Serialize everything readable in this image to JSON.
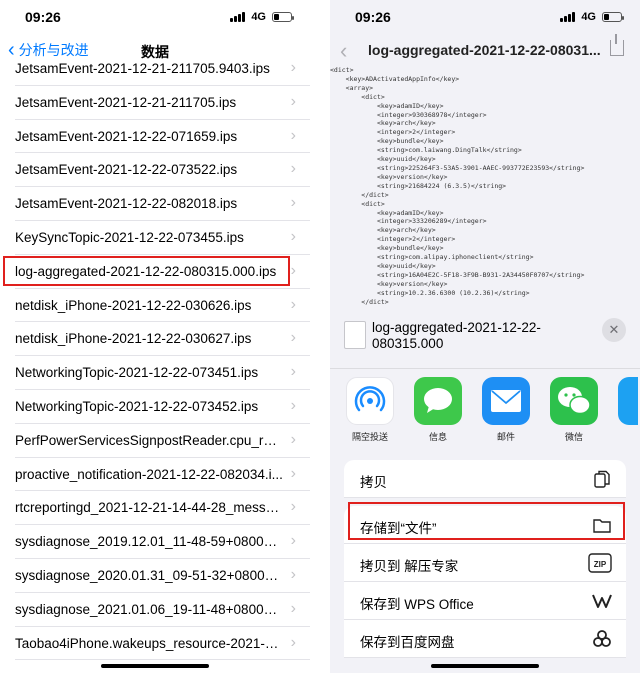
{
  "status": {
    "time": "09:26",
    "network": "4G"
  },
  "left": {
    "back_label": "分析与改进",
    "title": "数据",
    "items": [
      "JetsamEvent-2021-12-21-211705.9403.ips",
      "JetsamEvent-2021-12-21-211705.ips",
      "JetsamEvent-2021-12-22-071659.ips",
      "JetsamEvent-2021-12-22-073522.ips",
      "JetsamEvent-2021-12-22-082018.ips",
      "KeySyncTopic-2021-12-22-073455.ips",
      "log-aggregated-2021-12-22-080315.000.ips",
      "netdisk_iPhone-2021-12-22-030626.ips",
      "netdisk_iPhone-2021-12-22-030627.ips",
      "NetworkingTopic-2021-12-22-073451.ips",
      "NetworkingTopic-2021-12-22-073452.ips",
      "PerfPowerServicesSignpostReader.cpu_reso...",
      "proactive_notification-2021-12-22-082034.i...",
      "rtcreportingd_2021-12-21-14-44-28_messa...",
      "sysdiagnose_2019.12.01_11-48-59+0800_iP...",
      "sysdiagnose_2020.01.31_09-51-32+0800_i...",
      "sysdiagnose_2021.01.06_19-11-48+0800_iP...",
      "Taobao4iPhone.wakeups_resource-2021-12..."
    ]
  },
  "right": {
    "title": "log-aggregated-2021-12-22-08031...",
    "plist_lines": [
      "<dict>",
      "    <key>ADActivatedAppInfo</key>",
      "    <array>",
      "        <dict>",
      "            <key>adamID</key>",
      "            <integer>930368978</integer>",
      "            <key>arch</key>",
      "            <integer>2</integer>",
      "            <key>bundle</key>",
      "            <string>com.laiwang.DingTalk</string>",
      "            <key>uuid</key>",
      "            <string>225264F3-53A5-3901-AAEC-993772E23593</string>",
      "            <key>version</key>",
      "            <string>21684224 (6.3.5)</string>",
      "        </dict>",
      "        <dict>",
      "            <key>adamID</key>",
      "            <integer>333206289</integer>",
      "            <key>arch</key>",
      "            <integer>2</integer>",
      "            <key>bundle</key>",
      "            <string>com.alipay.iphoneclient</string>",
      "            <key>uuid</key>",
      "            <string>16A04E2C-5F18-3F9B-B931-2A34450F0707</string>",
      "            <key>version</key>",
      "            <string>10.2.36.6300 (10.2.36)</string>",
      "        </dict>"
    ],
    "file_name": "log-aggregated-2021-12-22-080315.000",
    "apps": [
      {
        "label": "隔空投送",
        "icon": "airdrop-icon"
      },
      {
        "label": "信息",
        "icon": "messages-icon"
      },
      {
        "label": "邮件",
        "icon": "mail-icon"
      },
      {
        "label": "微信",
        "icon": "wechat-icon"
      }
    ],
    "actions": [
      {
        "label": "拷贝",
        "icon": "copy-icon"
      },
      {
        "label": "存储到“文件”",
        "icon": "folder-icon"
      },
      {
        "label": "拷贝到 解压专家",
        "icon": "zip-icon"
      },
      {
        "label": "保存到 WPS Office",
        "icon": "wps-icon"
      },
      {
        "label": "保存到百度网盘",
        "icon": "baidu-netdisk-icon"
      }
    ],
    "zip_icon_text": "ZIP"
  }
}
